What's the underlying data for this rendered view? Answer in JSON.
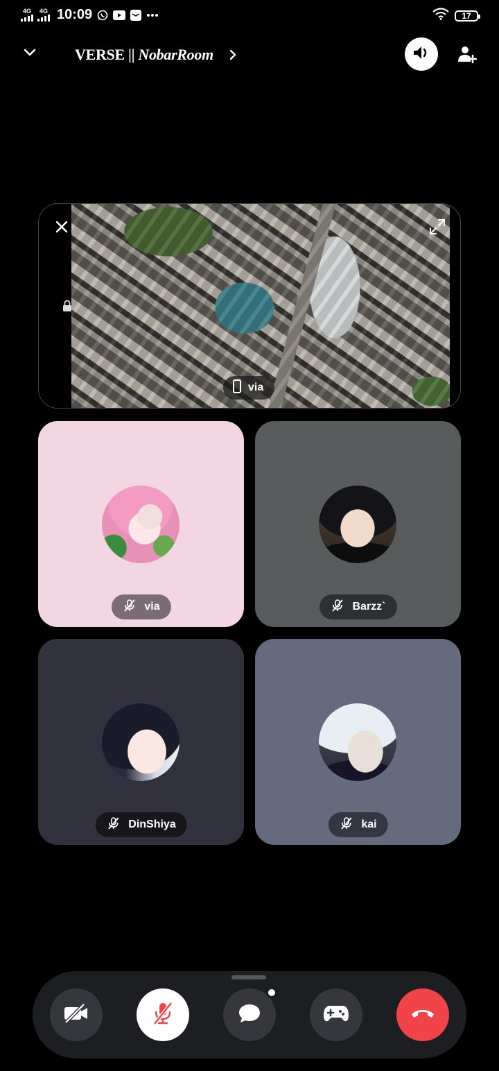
{
  "status_bar": {
    "network_1": "4G",
    "network_2": "4G",
    "time": "10:09",
    "battery": "17"
  },
  "header": {
    "title_bold": "VERSE || ",
    "title_italic": "NobarRoom"
  },
  "shared_screen": {
    "owner_name": "via",
    "device_icon": "phone-icon"
  },
  "participants": [
    {
      "name": "via",
      "tile_color": "#f2d6e2",
      "muted": true
    },
    {
      "name": "Barzz`",
      "tile_color": "#585c5c",
      "muted": true
    },
    {
      "name": "DinShiya",
      "tile_color": "#32323e",
      "muted": true
    },
    {
      "name": "kai",
      "tile_color": "#666a7e",
      "muted": true
    }
  ],
  "controls": {
    "camera": "camera-off-icon",
    "mic": "mic-off-icon",
    "chat": "chat-icon",
    "activities": "gamepad-icon",
    "end_call": "hang-up-icon",
    "end_call_color": "#f0444a"
  }
}
